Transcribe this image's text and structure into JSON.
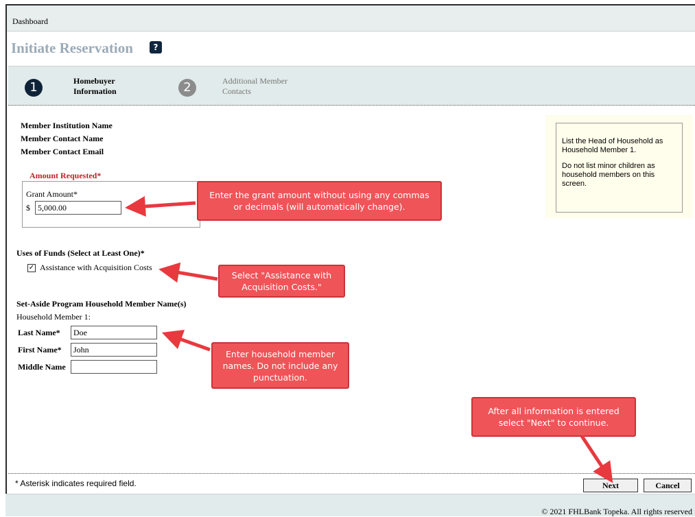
{
  "breadcrumb": "Dashboard",
  "page_title": "Initiate Reservation",
  "help_icon_label": "?",
  "steps": [
    {
      "number": "1",
      "label_line1": "Homebuyer",
      "label_line2": "Information"
    },
    {
      "number": "2",
      "label_line1": "Additional Member",
      "label_line2": "Contacts"
    }
  ],
  "member": {
    "institution_label": "Member Institution Name",
    "contact_name_label": "Member Contact Name",
    "contact_email_label": "Member Contact Email"
  },
  "amount": {
    "legend": "Amount Requested*",
    "grant_label": "Grant Amount*",
    "currency": "$",
    "value": "5,000.00"
  },
  "uses": {
    "heading": "Uses of Funds (Select at Least One)*",
    "option_label": "Assistance with Acquisition Costs",
    "checked_mark": "☑"
  },
  "household": {
    "heading": "Set-Aside Program Household Member Name(s)",
    "member_label": "Household Member 1:",
    "last_name_label": "Last Name*",
    "last_name_value": "Doe",
    "first_name_label": "First Name*",
    "first_name_value": "John",
    "middle_name_label": "Middle Name",
    "middle_name_value": ""
  },
  "note": {
    "line1": "List the Head of Household as Household Member 1.",
    "line2": "Do not list minor children as household members on this screen."
  },
  "callouts": {
    "grant": "Enter the grant amount without using any commas or decimals (will automatically change).",
    "uses": "Select \"Assistance with Acquisition Costs.\"",
    "names": "Enter household member names. Do not include any punctuation.",
    "next": "After all information is entered select \"Next\" to continue."
  },
  "required_note": "* Asterisk indicates required field.",
  "buttons": {
    "next": "Next",
    "cancel": "Cancel"
  },
  "footer": "© 2021 FHLBank Topeka. All rights reserved",
  "colors": {
    "callout": "#ef5458",
    "title": "#9aaab8",
    "required": "#c0202a"
  }
}
